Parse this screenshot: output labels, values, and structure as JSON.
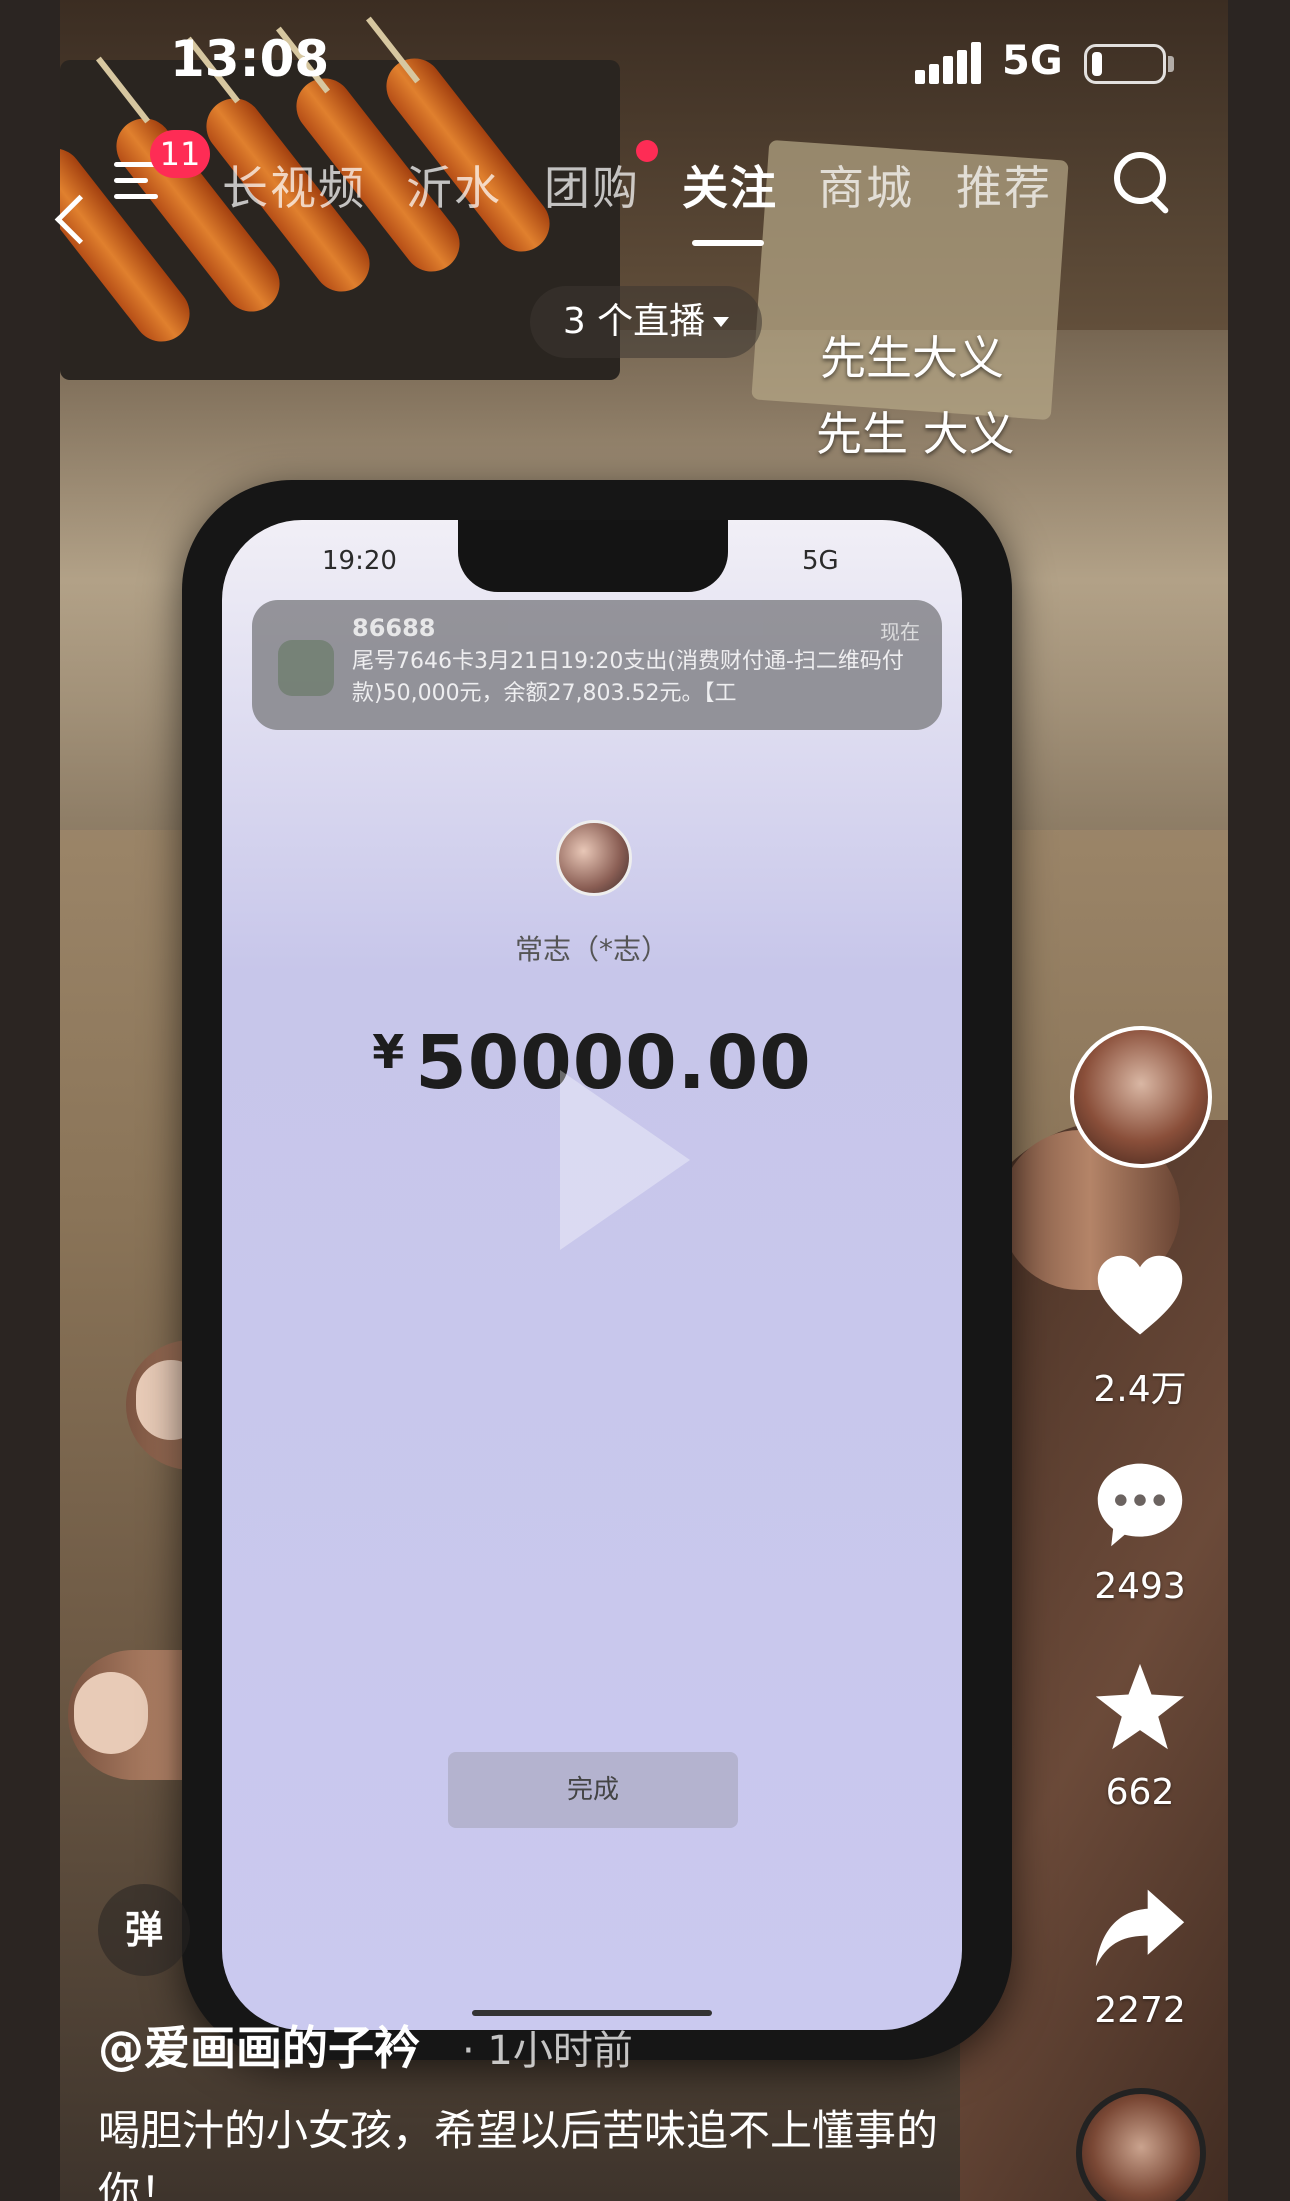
{
  "status_bar": {
    "time": "13:08",
    "network": "5G",
    "battery_fraction": 0.15
  },
  "top_nav": {
    "menu_badge": "11",
    "tabs": [
      "长视频",
      "沂水",
      "团购",
      "关注",
      "商城",
      "推荐"
    ],
    "active_tab": "关注"
  },
  "live_pill": {
    "label": "3 个直播"
  },
  "overlay_captions": [
    "先生大义",
    "先生 大义"
  ],
  "video_content": {
    "phone_time": "19:20",
    "phone_network": "5G",
    "notification": {
      "sender": "86688",
      "time": "现在",
      "text": "尾号7646卡3月21日19:20支出(消费财付通-扫二维码付款)50,000元，余额27,803.52元。【工"
    },
    "payee_name": "常志（*志）",
    "currency": "¥",
    "amount": "50000.00",
    "done_button": "完成"
  },
  "right_rail": {
    "likes": "2.4万",
    "comments": "2493",
    "favorites": "662",
    "shares": "2272",
    "icons": [
      "heart-icon",
      "comment-icon",
      "star-icon",
      "share-icon"
    ]
  },
  "bottom": {
    "danmu_label": "弹",
    "author": "@爱画画的子衿",
    "post_time": "· 1小时前",
    "description": "喝胆汁的小女孩，希望以后苦味追不上懂事的你！"
  },
  "colors": {
    "accent": "#fe2c55",
    "text": "#ffffff"
  }
}
